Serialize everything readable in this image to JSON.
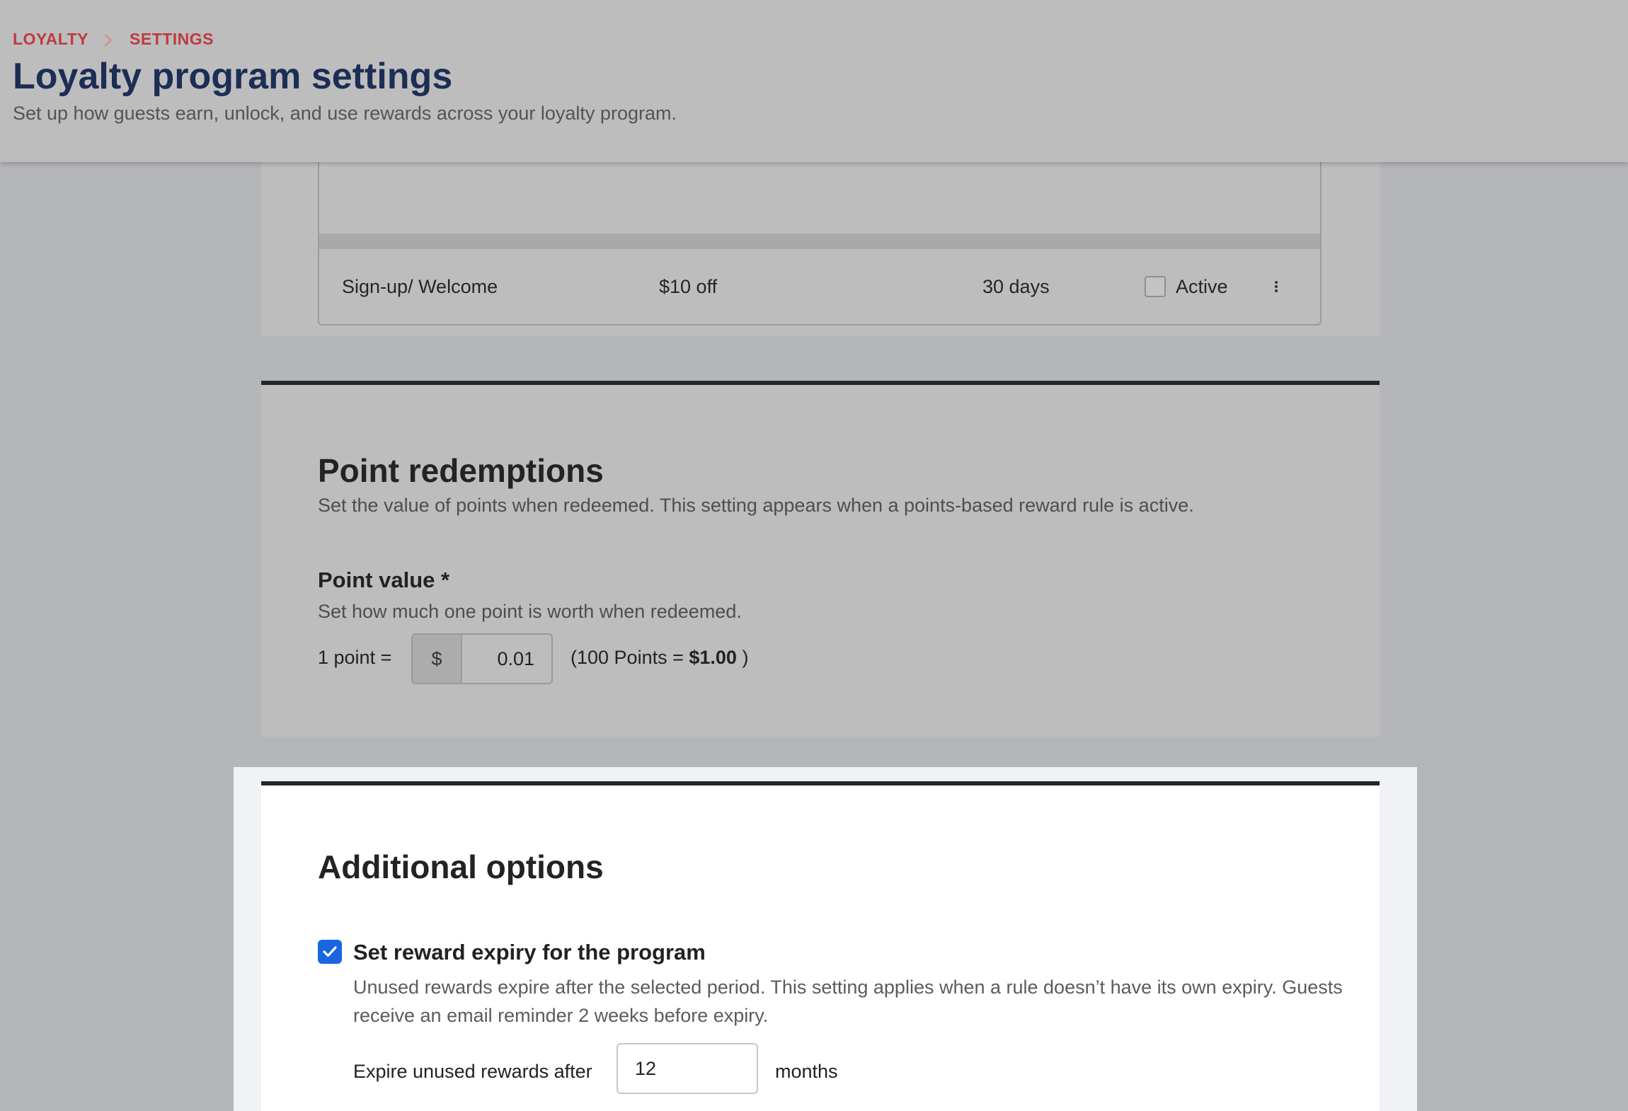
{
  "header": {
    "breadcrumb": [
      "LOYALTY",
      "SETTINGS"
    ],
    "title": "Loyalty program settings",
    "subtitle": "Set up how guests earn, unlock, and use rewards across your loyalty program."
  },
  "reward_rules": {
    "rows": [
      {
        "name": "Sign-up/ Welcome",
        "reward": "$10 off",
        "expiry": "30 days",
        "status_label": "Active",
        "active": false
      }
    ]
  },
  "point_redemptions": {
    "title": "Point redemptions",
    "description": "Set the value of points when redeemed. This setting appears when a points-based reward rule is active.",
    "field_label": "Point value *",
    "field_help": "Set how much one point is worth when redeemed.",
    "equation_prefix": "1 point =",
    "currency_symbol": "$",
    "value": "0.01",
    "equivalence_open": "(100 Points = ",
    "equivalence_amount": "$1.00",
    "equivalence_close": " )"
  },
  "additional_options": {
    "title": "Additional options",
    "reward_expiry": {
      "label": "Set reward expiry for the program",
      "checked": true,
      "description": "Unused rewards expire after the selected period. This setting applies when a rule doesn’t have its own expiry. Guests receive an email reminder 2 weeks before expiry.",
      "expire_label": "Expire unused rewards after",
      "value": "12",
      "unit": "months"
    }
  },
  "colors": {
    "breadcrumb": "#bf3a3f",
    "title": "#1c2e55",
    "checkbox_accent": "#1a66e0",
    "section_rule": "#27282c",
    "overlay_backdrop": "#b5b6ba"
  },
  "icons": {
    "breadcrumb_separator": "chevron-right-icon",
    "row_menu": "more-vertical-icon",
    "checkbox_checked": "check-icon"
  }
}
